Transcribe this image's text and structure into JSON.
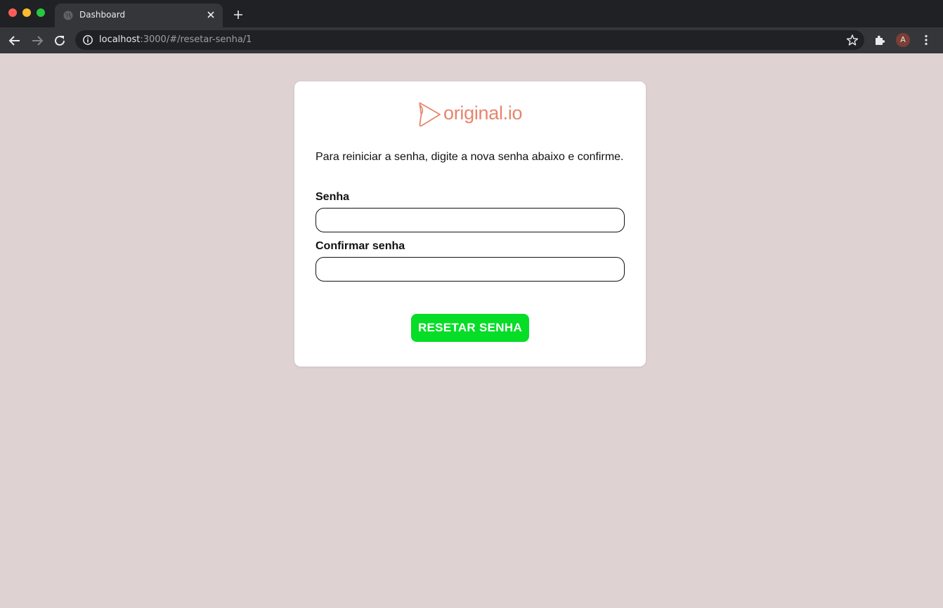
{
  "browser": {
    "tab_title": "Dashboard",
    "url_host": "localhost",
    "url_rest": ":3000/#/resetar-senha/1",
    "avatar_letter": "A"
  },
  "page": {
    "logo_text": "original.io",
    "instructions": "Para reiniciar a senha, digite a nova senha abaixo e confirme.",
    "password_label": "Senha",
    "password_value": "",
    "confirm_label": "Confirmar senha",
    "confirm_value": "",
    "submit_label": "RESETAR SENHA"
  },
  "colors": {
    "page_background": "#ded2d2",
    "brand": "#e7856c",
    "button": "#06dd27"
  },
  "icons": [
    "globe-icon",
    "close-icon",
    "plus-icon",
    "back-arrow-icon",
    "forward-arrow-icon",
    "reload-icon",
    "info-icon",
    "star-icon",
    "puzzle-icon",
    "kebab-menu-icon",
    "play-logo-icon"
  ]
}
